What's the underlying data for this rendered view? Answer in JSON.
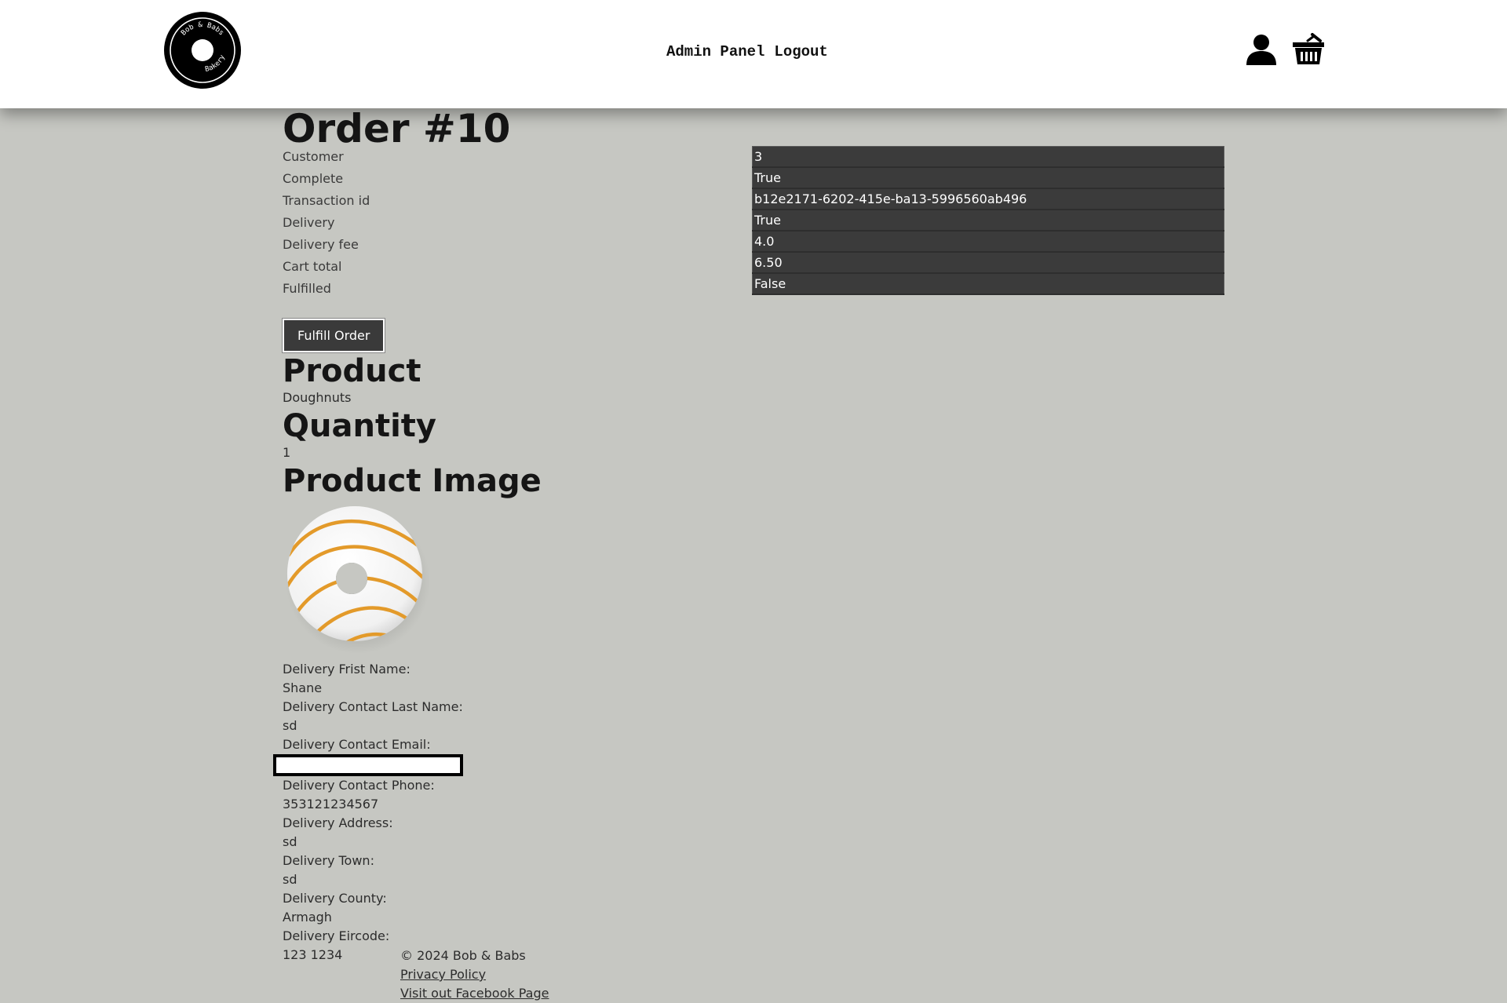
{
  "header": {
    "logo": {
      "top_text": "Bob & Babs",
      "bottom_text": "Bakery"
    },
    "nav": [
      {
        "label": "Admin Panel"
      },
      {
        "label": "Logout"
      }
    ],
    "icons": [
      "user-icon",
      "basket-icon"
    ]
  },
  "order": {
    "title": "Order #10",
    "fields": [
      {
        "label": "Customer",
        "value": "3"
      },
      {
        "label": "Complete",
        "value": "True"
      },
      {
        "label": "Transaction id",
        "value": "b12e2171-6202-415e-ba13-5996560ab496"
      },
      {
        "label": "Delivery",
        "value": "True"
      },
      {
        "label": "Delivery fee",
        "value": "4.0"
      },
      {
        "label": "Cart total",
        "value": "6.50"
      },
      {
        "label": "Fulfilled",
        "value": "False"
      }
    ],
    "fulfill_button": "Fulfill Order"
  },
  "product": {
    "heading": "Product",
    "name": "Doughnuts",
    "quantity_heading": "Quantity",
    "quantity": "1",
    "image_heading": "Product Image",
    "image_icon": "doughnut-image"
  },
  "delivery": {
    "first_name_label": "Delivery Frist Name:",
    "first_name": "Shane",
    "last_name_label": "Delivery Contact Last Name:",
    "last_name": "sd",
    "email_label": "Delivery Contact Email:",
    "email": "",
    "phone_label": "Delivery Contact Phone:",
    "phone": "353121234567",
    "address_label": "Delivery Address:",
    "address": "sd",
    "town_label": "Delivery Town:",
    "town": "sd",
    "county_label": "Delivery County:",
    "county": "Armagh",
    "eircode_label": "Delivery Eircode:",
    "eircode": "123 1234"
  },
  "footer": {
    "copyright": "© 2024 Bob & Babs",
    "privacy": "Privacy Policy",
    "facebook": "Visit out Facebook Page"
  },
  "colors": {
    "background": "#c6c7c2",
    "header": "#ffffff",
    "table_bg": "#3b3b3b",
    "button_bg": "#3a3a3a"
  }
}
